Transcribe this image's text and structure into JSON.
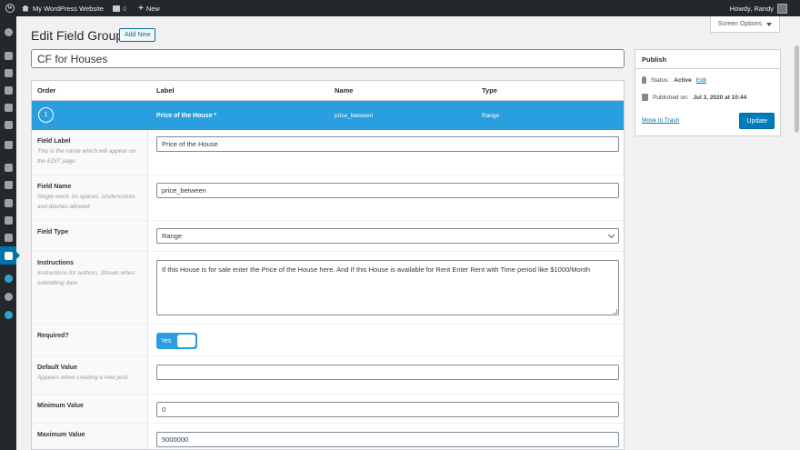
{
  "adminbar": {
    "logo": "W",
    "site_name": "My WordPress Website",
    "comments_count": "0",
    "new_label": "New",
    "howdy": "Howdy, Randy"
  },
  "header": {
    "title": "Edit Field Group",
    "add_new": "Add New",
    "screen_options": "Screen Options"
  },
  "group_title": "CF for Houses",
  "table": {
    "columns": [
      "Order",
      "Label",
      "Name",
      "Type"
    ],
    "row": {
      "order": "1",
      "label": "Price of the House *",
      "name": "price_between",
      "type": "Range"
    }
  },
  "settings": {
    "field_label": {
      "title": "Field Label",
      "desc": "This is the name which will appear on the EDIT page",
      "value": "Price of the House"
    },
    "field_name": {
      "title": "Field Name",
      "desc": "Single word, no spaces. Underscores and dashes allowed",
      "value": "price_between"
    },
    "field_type": {
      "title": "Field Type",
      "value": "Range"
    },
    "instructions": {
      "title": "Instructions",
      "desc": "Instructions for authors. Shown when submitting data",
      "value": "If this House is for sale enter the Price of the House here. And If this House is available for Rent Enter Rent with Time period like $1000/Month"
    },
    "required": {
      "title": "Required?",
      "value": "Yes"
    },
    "default_value": {
      "title": "Default Value",
      "desc": "Appears when creating a new post",
      "value": ""
    },
    "minimum_value": {
      "title": "Minimum Value",
      "value": "0"
    },
    "maximum_value": {
      "title": "Maximum Value",
      "value": "5000000"
    }
  },
  "publish": {
    "title": "Publish",
    "status_label": "Status:",
    "status_value": "Active",
    "status_edit": "Edit",
    "published_label": "Published on:",
    "published_value": "Jul 3, 2020 at 10:44",
    "trash": "Move to Trash",
    "update": "Update"
  },
  "colors": {
    "accent": "#0073aa",
    "row_highlight": "#2a9fe0",
    "adminbar": "#23282d"
  }
}
